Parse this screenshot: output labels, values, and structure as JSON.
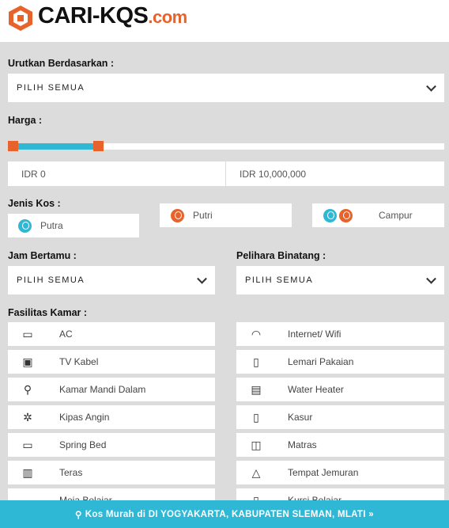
{
  "logo": {
    "brand": "CARI-KQS",
    "suffix": ".com"
  },
  "sort": {
    "label": "Urutkan Berdasarkan :",
    "value": "PILIH SEMUA"
  },
  "price": {
    "label": "Harga :",
    "min": "IDR 0",
    "max": "IDR 10,000,000",
    "slider_range_fraction": [
      0,
      0.2
    ],
    "track_color": "#2eb8d6",
    "handle_color": "#e8622c"
  },
  "kos_type": {
    "label": "Jenis Kos :",
    "options": [
      "Putra",
      "Putri",
      "Campur"
    ],
    "male_color": "#2eb8d6",
    "female_color": "#e8622c"
  },
  "visit_hours": {
    "label": "Jam Bertamu :",
    "value": "PILIH SEMUA"
  },
  "pets": {
    "label": "Pelihara Binatang :",
    "value": "PILIH SEMUA"
  },
  "facilities": {
    "label": "Fasilitas Kamar :",
    "items": [
      {
        "label": "AC",
        "icon": "ac-icon"
      },
      {
        "label": "Internet/ Wifi",
        "icon": "wifi-icon"
      },
      {
        "label": "TV Kabel",
        "icon": "tv-icon"
      },
      {
        "label": "Lemari Pakaian",
        "icon": "wardrobe-icon"
      },
      {
        "label": "Kamar Mandi Dalam",
        "icon": "shower-icon"
      },
      {
        "label": "Water Heater",
        "icon": "water-heater-icon"
      },
      {
        "label": "Kipas Angin",
        "icon": "fan-icon"
      },
      {
        "label": "Kasur",
        "icon": "mattress-icon"
      },
      {
        "label": "Spring Bed",
        "icon": "spring-bed-icon"
      },
      {
        "label": "Matras",
        "icon": "mat-icon"
      },
      {
        "label": "Teras",
        "icon": "terrace-icon"
      },
      {
        "label": "Tempat Jemuran",
        "icon": "hanger-icon"
      },
      {
        "label": "Meja Belajar",
        "icon": "desk-icon"
      },
      {
        "label": "Kursi Belajar",
        "icon": "chair-icon"
      }
    ]
  },
  "footer": {
    "text": "Kos Murah di DI YOGYAKARTA, KABUPATEN SLEMAN, MLATI »"
  }
}
